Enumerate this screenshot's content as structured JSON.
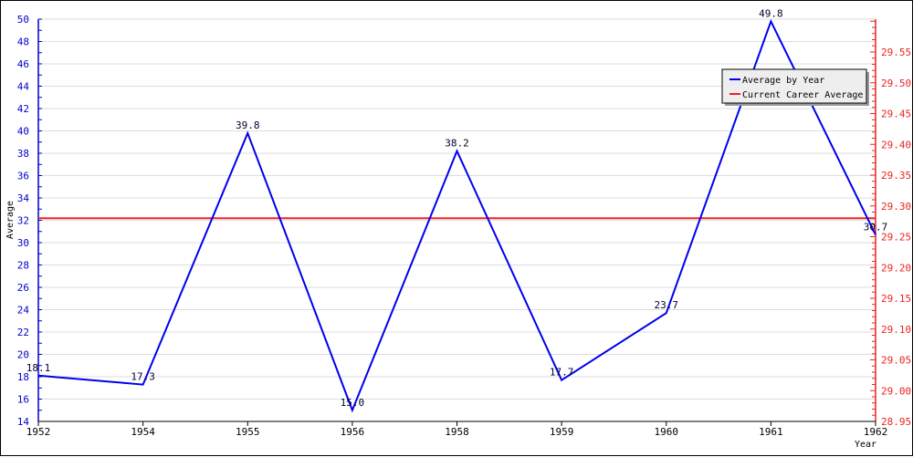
{
  "chart_data": {
    "type": "line",
    "title": "",
    "xlabel": "Year",
    "ylabel": "Average",
    "categories": [
      "1952",
      "1954",
      "1955",
      "1956",
      "1958",
      "1959",
      "1960",
      "1961",
      "1962"
    ],
    "series": [
      {
        "name": "Average by Year",
        "color": "#0000ee",
        "axis": "left",
        "values": [
          18.1,
          17.3,
          39.8,
          15.0,
          38.2,
          17.7,
          23.7,
          49.8,
          30.7
        ],
        "data_labels": [
          "18.1",
          "17.3",
          "39.8",
          "15.0",
          "38.2",
          "17.7",
          "23.7",
          "49.8",
          "30.7"
        ]
      },
      {
        "name": "Current Career Average",
        "color": "#ee2222",
        "axis": "right",
        "value": 29.28
      }
    ],
    "left_axis": {
      "ylim": [
        14,
        50
      ],
      "major_ticks": [
        14,
        16,
        18,
        20,
        22,
        24,
        26,
        28,
        30,
        32,
        34,
        36,
        38,
        40,
        42,
        44,
        46,
        48,
        50
      ],
      "tick_labels": [
        "14",
        "16",
        "18",
        "20",
        "22",
        "24",
        "26",
        "28",
        "30",
        "32",
        "34",
        "36",
        "38",
        "40",
        "42",
        "44",
        "46",
        "48",
        "50"
      ],
      "color": "#0000cc"
    },
    "right_axis": {
      "ylim": [
        28.95,
        29.6
      ],
      "major_ticks": [
        28.95,
        29.0,
        29.05,
        29.1,
        29.15,
        29.2,
        29.25,
        29.3,
        29.35,
        29.4,
        29.45,
        29.5,
        29.55
      ],
      "tick_labels": [
        "28.95",
        "29.00",
        "29.05",
        "29.10",
        "29.15",
        "29.20",
        "29.25",
        "29.30",
        "29.35",
        "29.40",
        "29.45",
        "29.50",
        "29.55"
      ],
      "color": "#ee2222"
    },
    "grid": true,
    "legend": {
      "position": "top-right",
      "entries": [
        {
          "label": "Average by Year",
          "color": "#0000ee"
        },
        {
          "label": "Current Career Average",
          "color": "#ee2222"
        }
      ]
    }
  }
}
